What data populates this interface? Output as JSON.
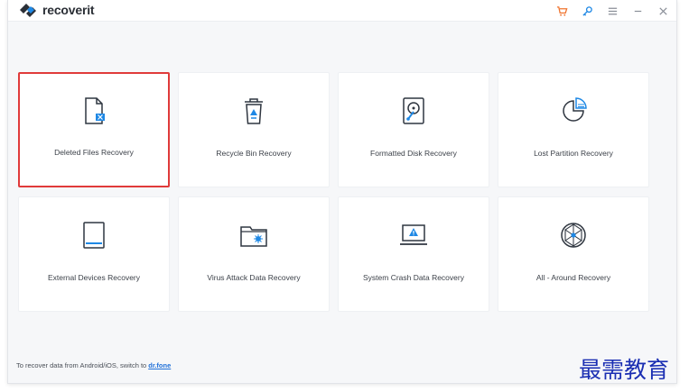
{
  "app": {
    "brand_main": "recover",
    "brand_suffix": "it"
  },
  "titlebar_controls": [
    {
      "name": "cart-icon",
      "color": "#f0742f"
    },
    {
      "name": "key-icon",
      "color": "#1e88e5"
    },
    {
      "name": "menu-icon",
      "color": "#8a8f98"
    },
    {
      "name": "minimize-icon",
      "color": "#8a8f98"
    },
    {
      "name": "close-icon",
      "color": "#8a8f98"
    }
  ],
  "modes": [
    {
      "label": "Deleted Files Recovery",
      "icon": "deleted-file-icon",
      "selected": true
    },
    {
      "label": "Recycle Bin Recovery",
      "icon": "recycle-bin-icon",
      "selected": false
    },
    {
      "label": "Formatted Disk Recovery",
      "icon": "formatted-disk-icon",
      "selected": false
    },
    {
      "label": "Lost Partition Recovery",
      "icon": "lost-partition-icon",
      "selected": false
    },
    {
      "label": "External Devices Recovery",
      "icon": "external-device-icon",
      "selected": false
    },
    {
      "label": "Virus Attack Data Recovery",
      "icon": "virus-attack-icon",
      "selected": false
    },
    {
      "label": "System Crash Data Recovery",
      "icon": "system-crash-icon",
      "selected": false
    },
    {
      "label": "All - Around Recovery",
      "icon": "all-around-icon",
      "selected": false
    }
  ],
  "footer": {
    "text": "To recover data from Android/iOS, switch to",
    "link": "dr.fone"
  },
  "watermark": "最需教育",
  "colors": {
    "accent": "#1e88e5",
    "selected_border": "#e03a3a",
    "icon_stroke": "#2f3640"
  }
}
